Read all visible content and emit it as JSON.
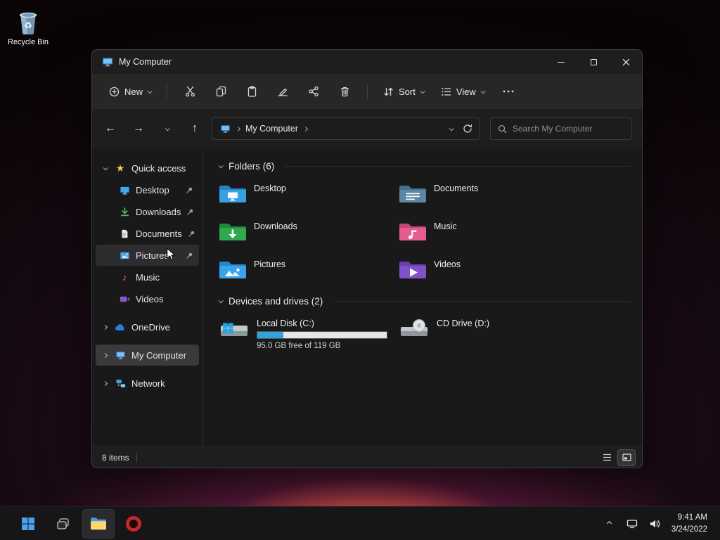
{
  "colors": {
    "accent": "#0078d4",
    "progress_fill": "#2fa3dc",
    "folder_desktop": "#38a1e2",
    "folder_desktop_dark": "#2484c4",
    "folder_documents": "#5b87a5",
    "folder_documents_dark": "#47708c",
    "folder_downloads": "#2fa84f",
    "folder_downloads_dark": "#1f8a3c",
    "folder_music": "#e35d8f",
    "folder_music_dark": "#c44677",
    "folder_pictures": "#3ba3ea",
    "folder_pictures_dark": "#2486cc",
    "folder_videos": "#8250c8",
    "folder_videos_dark": "#6a3fae"
  },
  "desktop": {
    "recycle_bin_label": "Recycle Bin"
  },
  "window": {
    "title": "My Computer",
    "command_bar": {
      "new_label": "New",
      "sort_label": "Sort",
      "view_label": "View"
    },
    "navbar": {
      "breadcrumb_root": "My Computer",
      "search_placeholder": "Search My Computer"
    },
    "sidebar": {
      "quick_access": "Quick access",
      "items": [
        {
          "label": "Desktop"
        },
        {
          "label": "Downloads"
        },
        {
          "label": "Documents"
        },
        {
          "label": "Pictures"
        },
        {
          "label": "Music"
        },
        {
          "label": "Videos"
        }
      ],
      "onedrive": "OneDrive",
      "this_pc": "My Computer",
      "network": "Network"
    },
    "content": {
      "folders_header": "Folders (6)",
      "folders": [
        {
          "name": "Desktop"
        },
        {
          "name": "Documents"
        },
        {
          "name": "Downloads"
        },
        {
          "name": "Music"
        },
        {
          "name": "Pictures"
        },
        {
          "name": "Videos"
        }
      ],
      "devices_header": "Devices and drives (2)",
      "drives": [
        {
          "name": "Local Disk (C:)",
          "caption": "95.0 GB free of 119 GB",
          "used_percent": 20
        },
        {
          "name": "CD Drive (D:)"
        }
      ]
    },
    "statusbar": {
      "items_count": "8 items"
    }
  },
  "taskbar": {
    "time": "9:41 AM",
    "date": "3/24/2022"
  }
}
